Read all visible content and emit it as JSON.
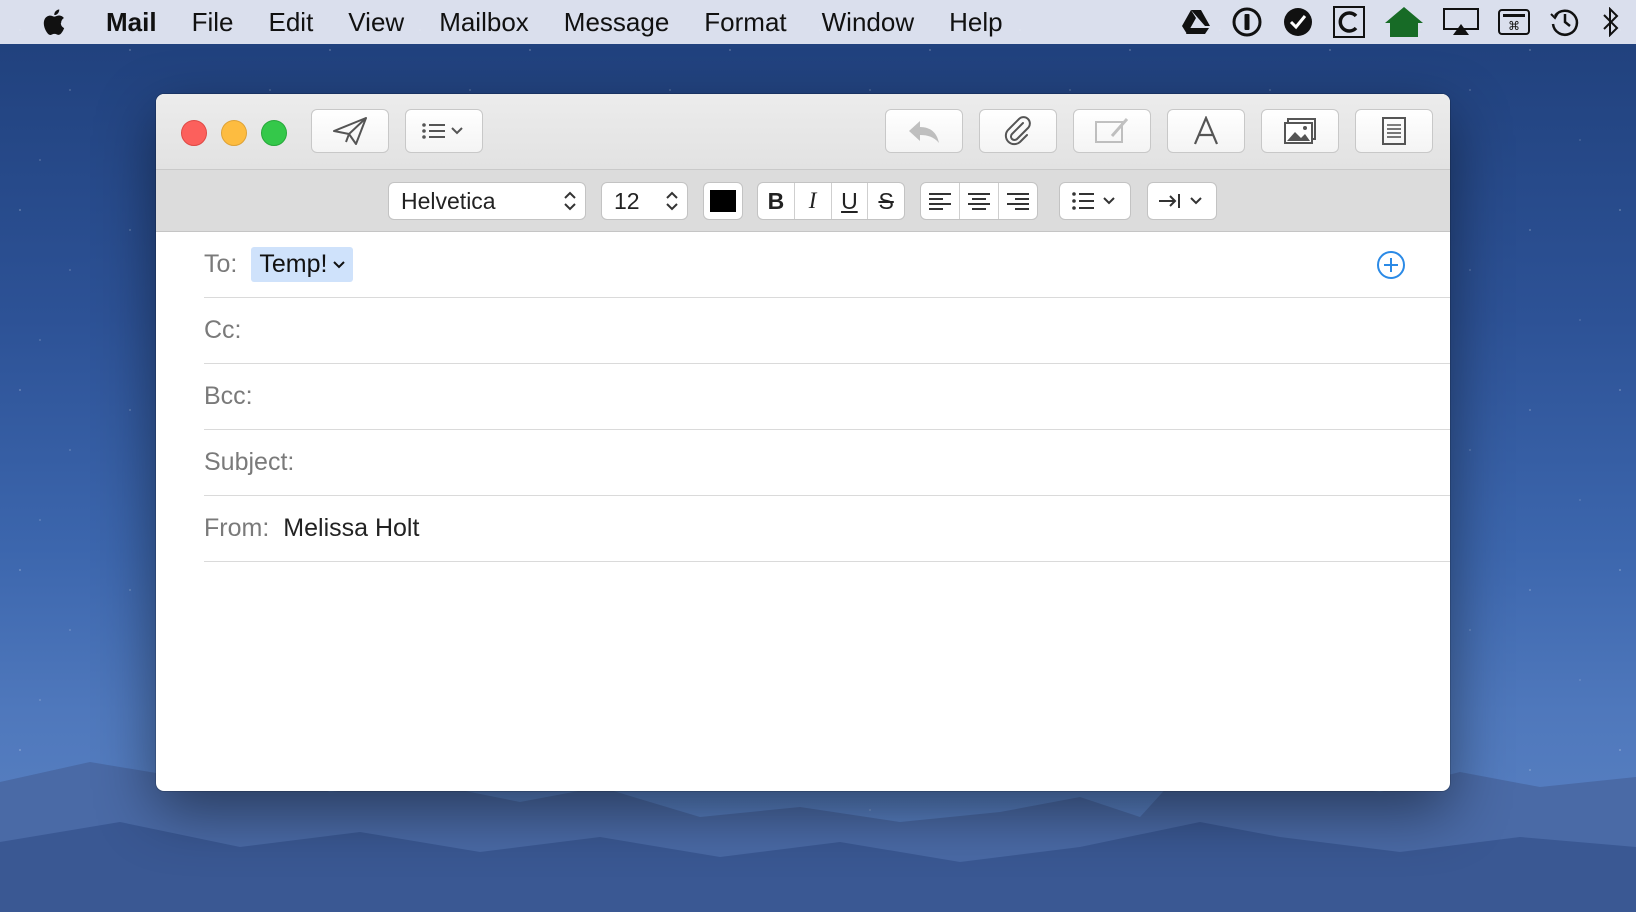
{
  "menubar": {
    "app": "Mail",
    "items": [
      "File",
      "Edit",
      "View",
      "Mailbox",
      "Message",
      "Format",
      "Window",
      "Help"
    ],
    "status_icons": [
      "google-drive-icon",
      "1password-icon",
      "checkmark-circle-icon",
      "c-app-icon",
      "home-icon",
      "airplay-icon",
      "keyboard-shortcut-icon",
      "time-machine-icon",
      "bluetooth-icon"
    ]
  },
  "toolbar": {
    "buttons": [
      "send",
      "header-fields-menu",
      "reply",
      "attach",
      "markup",
      "fonts",
      "photo-browser",
      "stationery"
    ]
  },
  "format": {
    "font": "Helvetica",
    "size": "12",
    "color": "#000000",
    "bold": "B",
    "italic": "I",
    "underline": "U",
    "strike": "S"
  },
  "compose": {
    "to_label": "To:",
    "to_token": "Temp!",
    "cc_label": "Cc:",
    "bcc_label": "Bcc:",
    "subject_label": "Subject:",
    "from_label": "From:",
    "from_value": "Melissa Holt"
  }
}
